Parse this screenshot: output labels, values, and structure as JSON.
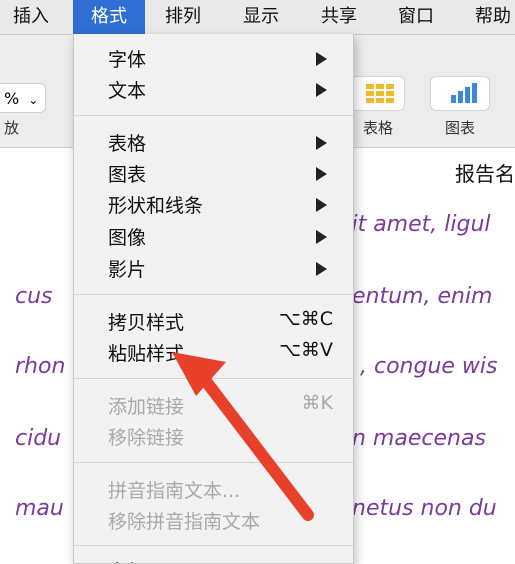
{
  "menubar": {
    "items": [
      {
        "label": "插入"
      },
      {
        "label": "格式",
        "active": true
      },
      {
        "label": "排列"
      },
      {
        "label": "显示"
      },
      {
        "label": "共享"
      },
      {
        "label": "窗口"
      },
      {
        "label": "帮助"
      }
    ]
  },
  "toolbar": {
    "zoom_value": "%",
    "zoom_label": "放",
    "table_label": "表格",
    "chart_label": "图表"
  },
  "document": {
    "title": "报告名",
    "lines": [
      "sit amet, ligul",
      "cus",
      "entum, enim",
      "rhon",
      ", congue wis",
      "cidu",
      "n maecenas",
      "mau",
      "netus non du"
    ]
  },
  "format_menu": {
    "font": {
      "label": "字体"
    },
    "text": {
      "label": "文本"
    },
    "table": {
      "label": "表格"
    },
    "chart": {
      "label": "图表"
    },
    "shapes_lines": {
      "label": "形状和线条"
    },
    "image": {
      "label": "图像"
    },
    "movie": {
      "label": "影片"
    },
    "copy_style": {
      "label": "拷贝样式",
      "shortcut": "⌥⌘C"
    },
    "paste_style": {
      "label": "粘贴样式",
      "shortcut": "⌥⌘V"
    },
    "add_link": {
      "label": "添加链接",
      "shortcut": "⌘K"
    },
    "remove_link": {
      "label": "移除链接"
    },
    "pinyin_text": {
      "label": "拼音指南文本..."
    },
    "remove_pinyin": {
      "label": "移除拼音指南文本"
    },
    "advanced": {
      "label": "高级"
    }
  },
  "colors": {
    "active_menu": "#2f6fd4",
    "doc_text": "#7b3b9a",
    "annotation_arrow": "#e8402a"
  }
}
